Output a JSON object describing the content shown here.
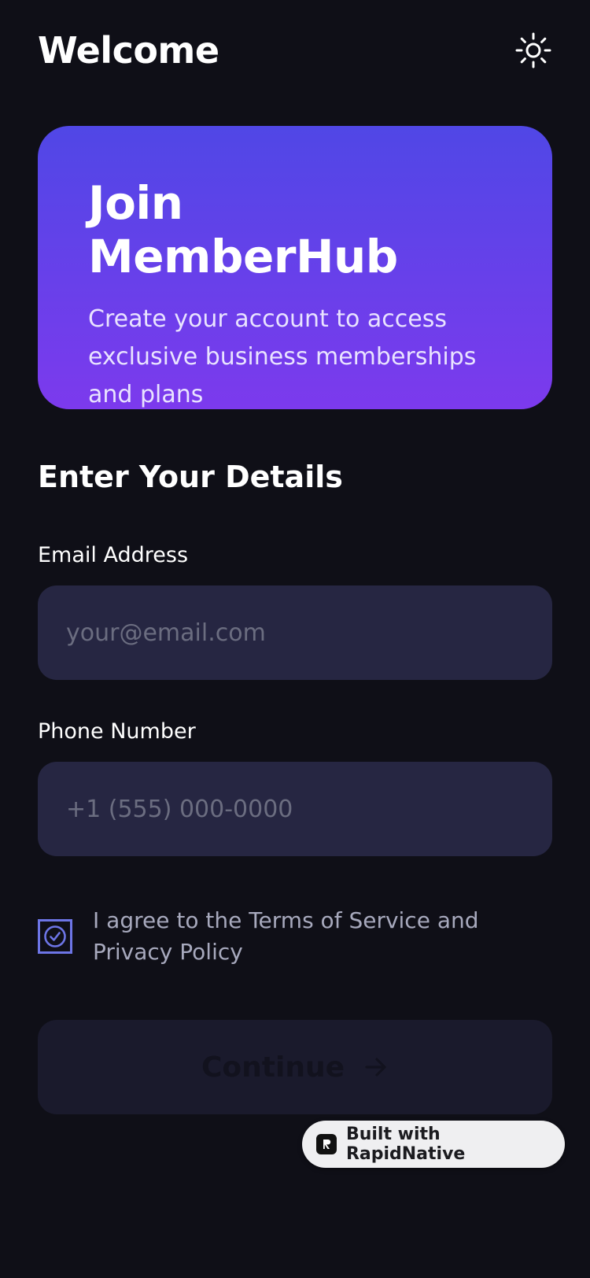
{
  "header": {
    "title": "Welcome",
    "theme_icon": "sun-icon"
  },
  "hero": {
    "title": "Join MemberHub",
    "subtitle": "Create your account to access exclusive business memberships and plans",
    "gradient_start": "#5047e6",
    "gradient_end": "#7c3aed"
  },
  "form": {
    "section_title": "Enter Your Details",
    "email": {
      "label": "Email Address",
      "placeholder": "your@email.com",
      "value": ""
    },
    "phone": {
      "label": "Phone Number",
      "placeholder": "+1 (555) 000-0000",
      "value": ""
    },
    "agree": {
      "text": "I agree to the Terms of Service and Privacy Policy",
      "checked": true,
      "icon": "check-circle-icon"
    },
    "continue": {
      "label": "Continue",
      "icon": "arrow-right-icon",
      "disabled": true
    }
  },
  "badge": {
    "text": "Built with RapidNative",
    "icon": "rapidnative-logo-icon"
  },
  "colors": {
    "background": "#0f0f17",
    "input_background": "#262642",
    "checkbox_accent": "#6d75e6",
    "button_disabled": "#1a1a2c"
  }
}
